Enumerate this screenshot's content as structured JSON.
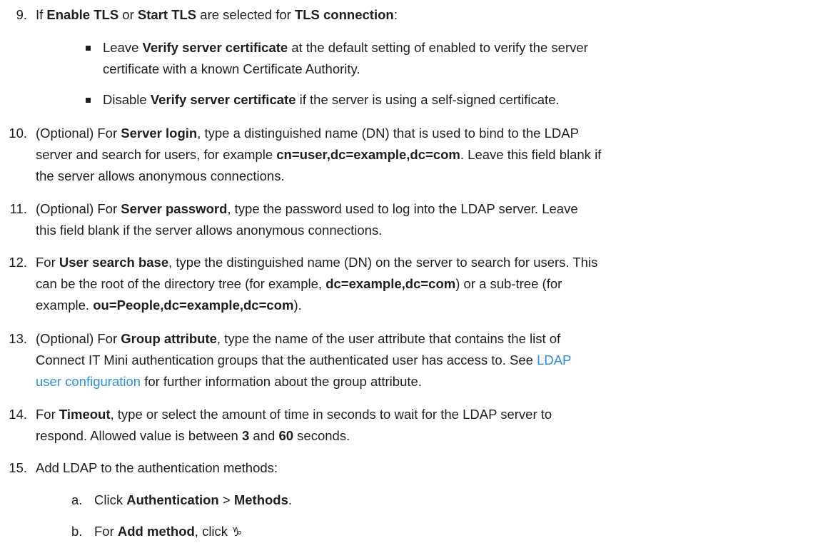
{
  "steps": {
    "s9": {
      "num": "9.",
      "p1": "If ",
      "b1": "Enable TLS",
      "p2": " or ",
      "b2": "Start TLS",
      "p3": " are selected for ",
      "b3": "TLS connection",
      "p4": ":",
      "bullets": [
        {
          "line1_a": "Leave ",
          "line1_b": "Verify server certificate",
          "line1_c": " at the default setting of enabled to verify the server",
          "line2": "certificate with a known Certificate Authority."
        },
        {
          "line1_a": "Disable ",
          "line1_b": "Verify server certificate",
          "line1_c": " if the server is using a self-signed certificate."
        }
      ]
    },
    "s10": {
      "num": "10.",
      "l1_a": "(Optional) For ",
      "l1_b": "Server login",
      "l1_c": ", type a distinguished name (DN) that is used to bind to the LDAP",
      "l2_a": "server and search for users, for example ",
      "l2_b": "cn=user,dc=example,dc=com",
      "l2_c": ". Leave this field blank if",
      "l3": "the server allows anonymous connections."
    },
    "s11": {
      "num": "11.",
      "l1_a": "(Optional) For ",
      "l1_b": "Server password",
      "l1_c": ", type the password used to log into the LDAP server. Leave",
      "l2": "this field blank if the server allows anonymous connections."
    },
    "s12": {
      "num": "12.",
      "l1_a": "For ",
      "l1_b": "User search base",
      "l1_c": ", type the distinguished name (DN) on the server to search for users. This",
      "l2_a": "can be the root of the directory tree (for example, ",
      "l2_b": "dc=example,dc=com",
      "l2_c": ") or a sub-tree (for",
      "l3_a": "example. ",
      "l3_b": "ou=People,dc=example,dc=com",
      "l3_c": ")."
    },
    "s13": {
      "num": "13.",
      "l1_a": "(Optional) For ",
      "l1_b": "Group attribute",
      "l1_c": ", type the name of the user attribute that contains the list of",
      "l2_a": "Connect IT Mini authentication groups that the authenticated user has access to. See ",
      "l2_link": "LDAP",
      "l3_link": "user configuration",
      "l3_c": " for further information about the group attribute."
    },
    "s14": {
      "num": "14.",
      "l1_a": "For ",
      "l1_b": "Timeout",
      "l1_c": ", type or select the amount of time in seconds to wait for the LDAP server to",
      "l2_a": "respond. Allowed value is between ",
      "l2_b": "3",
      "l2_c": " and ",
      "l2_d": "60",
      "l2_e": " seconds."
    },
    "s15": {
      "num": "15.",
      "l1": "Add LDAP to the authentication methods:",
      "subs": [
        {
          "letter": "a.",
          "p1": "Click ",
          "b1": "Authentication",
          "p2": " > ",
          "b2": "Methods",
          "p3": "."
        },
        {
          "letter": "b.",
          "p1": "For ",
          "b1": "Add method",
          "p2": ", click ",
          "glyph": "♑"
        }
      ]
    }
  }
}
